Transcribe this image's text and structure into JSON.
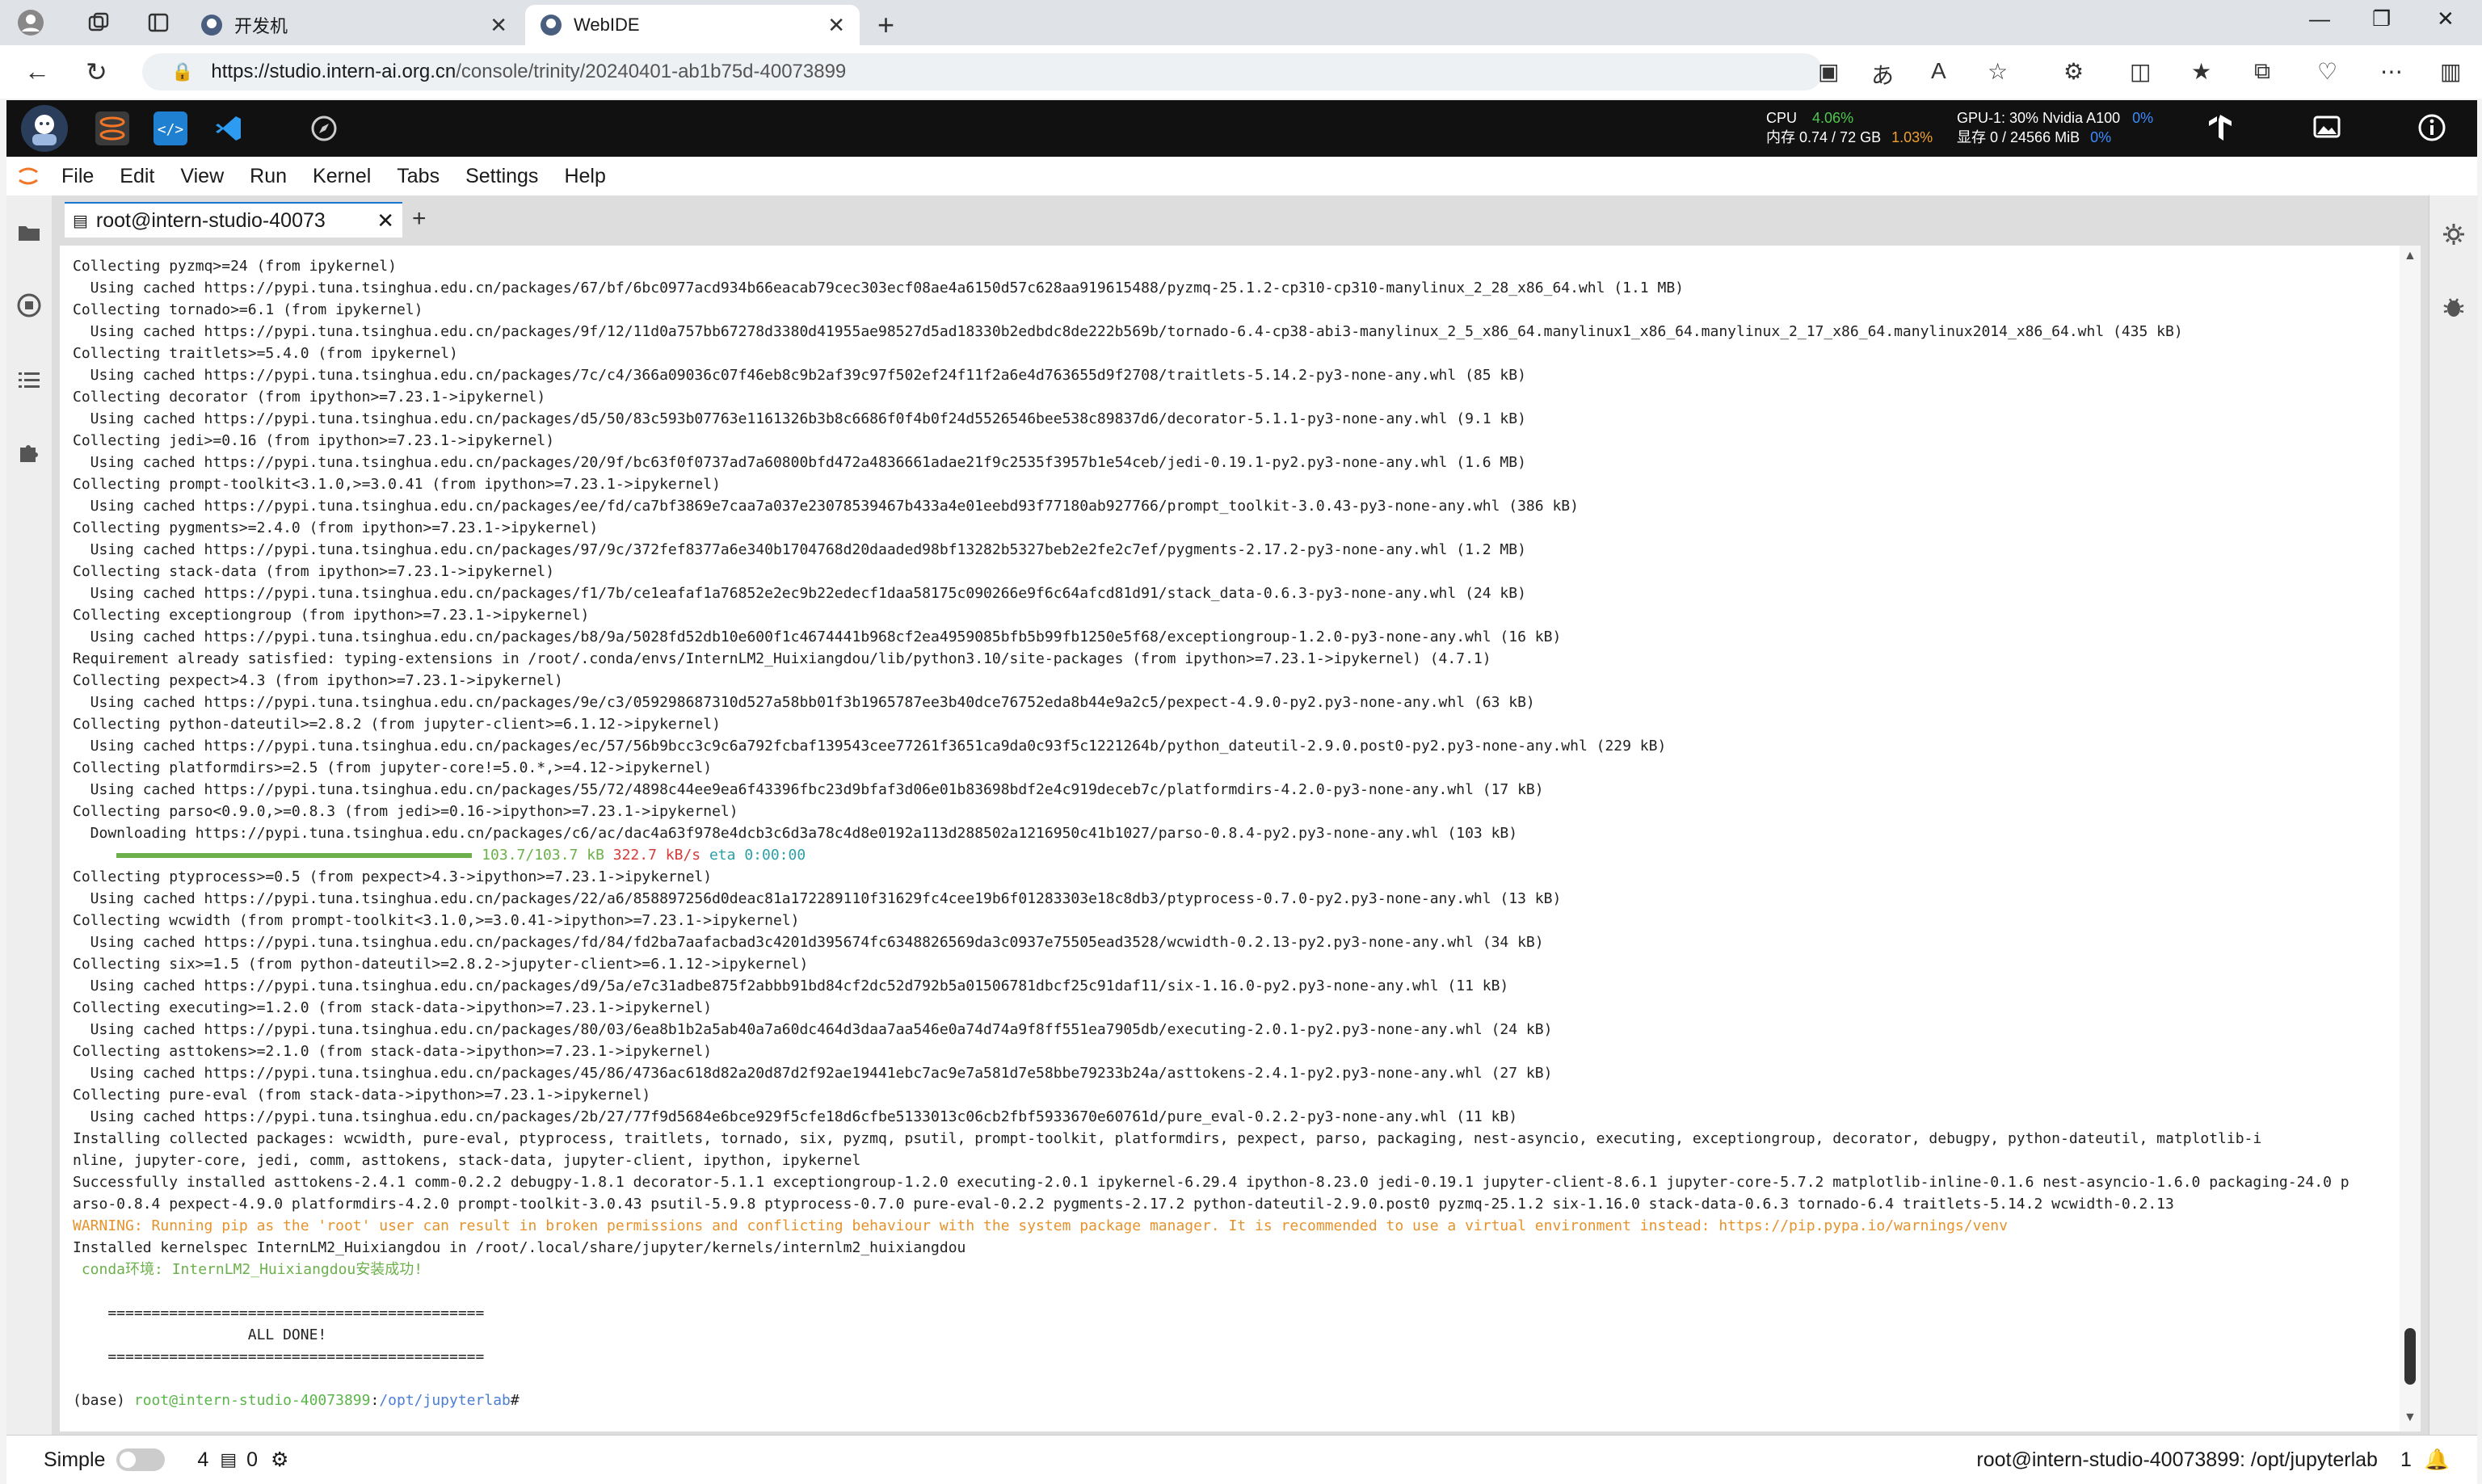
{
  "browser": {
    "tabs": [
      {
        "title": "开发机",
        "active": false
      },
      {
        "title": "WebIDE",
        "active": true
      }
    ],
    "url_host": "https://studio.intern-ai.org.cn",
    "url_path": "/console/trinity/20240401-ab1b75d-40073899"
  },
  "resources": {
    "cpu_label": "CPU",
    "cpu_value": "4.06%",
    "mem_label": "内存",
    "mem_value": "0.74 / 72 GB",
    "mem_pct": "1.03%",
    "gpu_label": "GPU-1: 30% Nvidia A100",
    "gpu_pct": "0%",
    "vram_label": "显存",
    "vram_value": "0 / 24566 MiB",
    "vram_pct": "0%"
  },
  "menu": [
    "File",
    "Edit",
    "View",
    "Run",
    "Kernel",
    "Tabs",
    "Settings",
    "Help"
  ],
  "doc_tab": {
    "title": "root@intern-studio-40073"
  },
  "terminal": {
    "lines": [
      "Collecting pyzmq>=24 (from ipykernel)",
      "  Using cached https://pypi.tuna.tsinghua.edu.cn/packages/67/bf/6bc0977acd934b66eacab79cec303ecf08ae4a6150d57c628aa919615488/pyzmq-25.1.2-cp310-cp310-manylinux_2_28_x86_64.whl (1.1 MB)",
      "Collecting tornado>=6.1 (from ipykernel)",
      "  Using cached https://pypi.tuna.tsinghua.edu.cn/packages/9f/12/11d0a757bb67278d3380d41955ae98527d5ad18330b2edbdc8de222b569b/tornado-6.4-cp38-abi3-manylinux_2_5_x86_64.manylinux1_x86_64.manylinux_2_17_x86_64.manylinux2014_x86_64.whl (435 kB)",
      "Collecting traitlets>=5.4.0 (from ipykernel)",
      "  Using cached https://pypi.tuna.tsinghua.edu.cn/packages/7c/c4/366a09036c07f46eb8c9b2af39c97f502ef24f11f2a6e4d763655d9f2708/traitlets-5.14.2-py3-none-any.whl (85 kB)",
      "Collecting decorator (from ipython>=7.23.1->ipykernel)",
      "  Using cached https://pypi.tuna.tsinghua.edu.cn/packages/d5/50/83c593b07763e1161326b3b8c6686f0f4b0f24d5526546bee538c89837d6/decorator-5.1.1-py3-none-any.whl (9.1 kB)",
      "Collecting jedi>=0.16 (from ipython>=7.23.1->ipykernel)",
      "  Using cached https://pypi.tuna.tsinghua.edu.cn/packages/20/9f/bc63f0f0737ad7a60800bfd472a4836661adae21f9c2535f3957b1e54ceb/jedi-0.19.1-py2.py3-none-any.whl (1.6 MB)",
      "Collecting prompt-toolkit<3.1.0,>=3.0.41 (from ipython>=7.23.1->ipykernel)",
      "  Using cached https://pypi.tuna.tsinghua.edu.cn/packages/ee/fd/ca7bf3869e7caa7a037e23078539467b433a4e01eebd93f77180ab927766/prompt_toolkit-3.0.43-py3-none-any.whl (386 kB)",
      "Collecting pygments>=2.4.0 (from ipython>=7.23.1->ipykernel)",
      "  Using cached https://pypi.tuna.tsinghua.edu.cn/packages/97/9c/372fef8377a6e340b1704768d20daaded98bf13282b5327beb2e2fe2c7ef/pygments-2.17.2-py3-none-any.whl (1.2 MB)",
      "Collecting stack-data (from ipython>=7.23.1->ipykernel)",
      "  Using cached https://pypi.tuna.tsinghua.edu.cn/packages/f1/7b/ce1eafaf1a76852e2ec9b22edecf1daa58175c090266e9f6c64afcd81d91/stack_data-0.6.3-py3-none-any.whl (24 kB)",
      "Collecting exceptiongroup (from ipython>=7.23.1->ipykernel)",
      "  Using cached https://pypi.tuna.tsinghua.edu.cn/packages/b8/9a/5028fd52db10e600f1c4674441b968cf2ea4959085bfb5b99fb1250e5f68/exceptiongroup-1.2.0-py3-none-any.whl (16 kB)",
      "Requirement already satisfied: typing-extensions in /root/.conda/envs/InternLM2_Huixiangdou/lib/python3.10/site-packages (from ipython>=7.23.1->ipykernel) (4.7.1)",
      "Collecting pexpect>4.3 (from ipython>=7.23.1->ipykernel)",
      "  Using cached https://pypi.tuna.tsinghua.edu.cn/packages/9e/c3/059298687310d527a58bb01f3b1965787ee3b40dce76752eda8b44e9a2c5/pexpect-4.9.0-py2.py3-none-any.whl (63 kB)",
      "Collecting python-dateutil>=2.8.2 (from jupyter-client>=6.1.12->ipykernel)",
      "  Using cached https://pypi.tuna.tsinghua.edu.cn/packages/ec/57/56b9bcc3c9c6a792fcbaf139543cee77261f3651ca9da0c93f5c1221264b/python_dateutil-2.9.0.post0-py2.py3-none-any.whl (229 kB)",
      "Collecting platformdirs>=2.5 (from jupyter-core!=5.0.*,>=4.12->ipykernel)",
      "  Using cached https://pypi.tuna.tsinghua.edu.cn/packages/55/72/4898c44ee9ea6f43396fbc23d9bfaf3d06e01b83698bdf2e4c919deceb7c/platformdirs-4.2.0-py3-none-any.whl (17 kB)",
      "Collecting parso<0.9.0,>=0.8.3 (from jedi>=0.16->ipython>=7.23.1->ipykernel)",
      "  Downloading https://pypi.tuna.tsinghua.edu.cn/packages/c6/ac/dac4a63f978e4dcb3c6d3a78c4d8e0192a113d288502a1216950c41b1027/parso-0.8.4-py2.py3-none-any.whl (103 kB)"
    ],
    "download": {
      "size": "103.7/103.7 kB",
      "speed": "322.7 kB/s",
      "eta": "eta 0:00:00"
    },
    "lines2": [
      "Collecting ptyprocess>=0.5 (from pexpect>4.3->ipython>=7.23.1->ipykernel)",
      "  Using cached https://pypi.tuna.tsinghua.edu.cn/packages/22/a6/858897256d0deac81a172289110f31629fc4cee19b6f01283303e18c8db3/ptyprocess-0.7.0-py2.py3-none-any.whl (13 kB)",
      "Collecting wcwidth (from prompt-toolkit<3.1.0,>=3.0.41->ipython>=7.23.1->ipykernel)",
      "  Using cached https://pypi.tuna.tsinghua.edu.cn/packages/fd/84/fd2ba7aafacbad3c4201d395674fc6348826569da3c0937e75505ead3528/wcwidth-0.2.13-py2.py3-none-any.whl (34 kB)",
      "Collecting six>=1.5 (from python-dateutil>=2.8.2->jupyter-client>=6.1.12->ipykernel)",
      "  Using cached https://pypi.tuna.tsinghua.edu.cn/packages/d9/5a/e7c31adbe875f2abbb91bd84cf2dc52d792b5a01506781dbcf25c91daf11/six-1.16.0-py2.py3-none-any.whl (11 kB)",
      "Collecting executing>=1.2.0 (from stack-data->ipython>=7.23.1->ipykernel)",
      "  Using cached https://pypi.tuna.tsinghua.edu.cn/packages/80/03/6ea8b1b2a5ab40a7a60dc464d3daa7aa546e0a74d74a9f8ff551ea7905db/executing-2.0.1-py2.py3-none-any.whl (24 kB)",
      "Collecting asttokens>=2.1.0 (from stack-data->ipython>=7.23.1->ipykernel)",
      "  Using cached https://pypi.tuna.tsinghua.edu.cn/packages/45/86/4736ac618d82a20d87d2f92ae19441ebc7ac9e7a581d7e58bbe79233b24a/asttokens-2.4.1-py2.py3-none-any.whl (27 kB)",
      "Collecting pure-eval (from stack-data->ipython>=7.23.1->ipykernel)",
      "  Using cached https://pypi.tuna.tsinghua.edu.cn/packages/2b/27/77f9d5684e6bce929f5cfe18d6cfbe5133013c06cb2fbf5933670e60761d/pure_eval-0.2.2-py3-none-any.whl (11 kB)",
      "Installing collected packages: wcwidth, pure-eval, ptyprocess, traitlets, tornado, six, pyzmq, psutil, prompt-toolkit, platformdirs, pexpect, parso, packaging, nest-asyncio, executing, exceptiongroup, decorator, debugpy, python-dateutil, matplotlib-i",
      "nline, jupyter-core, jedi, comm, asttokens, stack-data, jupyter-client, ipython, ipykernel",
      "Successfully installed asttokens-2.4.1 comm-0.2.2 debugpy-1.8.1 decorator-5.1.1 exceptiongroup-1.2.0 executing-2.0.1 ipykernel-6.29.4 ipython-8.23.0 jedi-0.19.1 jupyter-client-8.6.1 jupyter-core-5.7.2 matplotlib-inline-0.1.6 nest-asyncio-1.6.0 packaging-24.0 p",
      "arso-0.8.4 pexpect-4.9.0 platformdirs-4.2.0 prompt-toolkit-3.0.43 psutil-5.9.8 ptyprocess-0.7.0 pure-eval-0.2.2 pygments-2.17.2 python-dateutil-2.9.0.post0 pyzmq-25.1.2 six-1.16.0 stack-data-0.6.3 tornado-6.4 traitlets-5.14.2 wcwidth-0.2.13"
    ],
    "warning": "WARNING: Running pip as the 'root' user can result in broken permissions and conflicting behaviour with the system package manager. It is recommended to use a virtual environment instead: https://pip.pypa.io/warnings/venv",
    "installed": "Installed kernelspec InternLM2_Huixiangdou in /root/.local/share/jupyter/kernels/internlm2_huixiangdou",
    "conda_ok": " conda环境: InternLM2_Huixiangdou安装成功!",
    "sep": "    ===========================================",
    "done": "                    ALL DONE!",
    "prompt_env": "(base) ",
    "prompt_user": "root@intern-studio-40073899",
    "prompt_colon": ":",
    "prompt_path": "/opt/jupyterlab",
    "prompt_hash": "#"
  },
  "status": {
    "mode": "Simple",
    "count1": "4",
    "count2": "0",
    "right_text": "root@intern-studio-40073899: /opt/jupyterlab",
    "right_num": "1"
  }
}
